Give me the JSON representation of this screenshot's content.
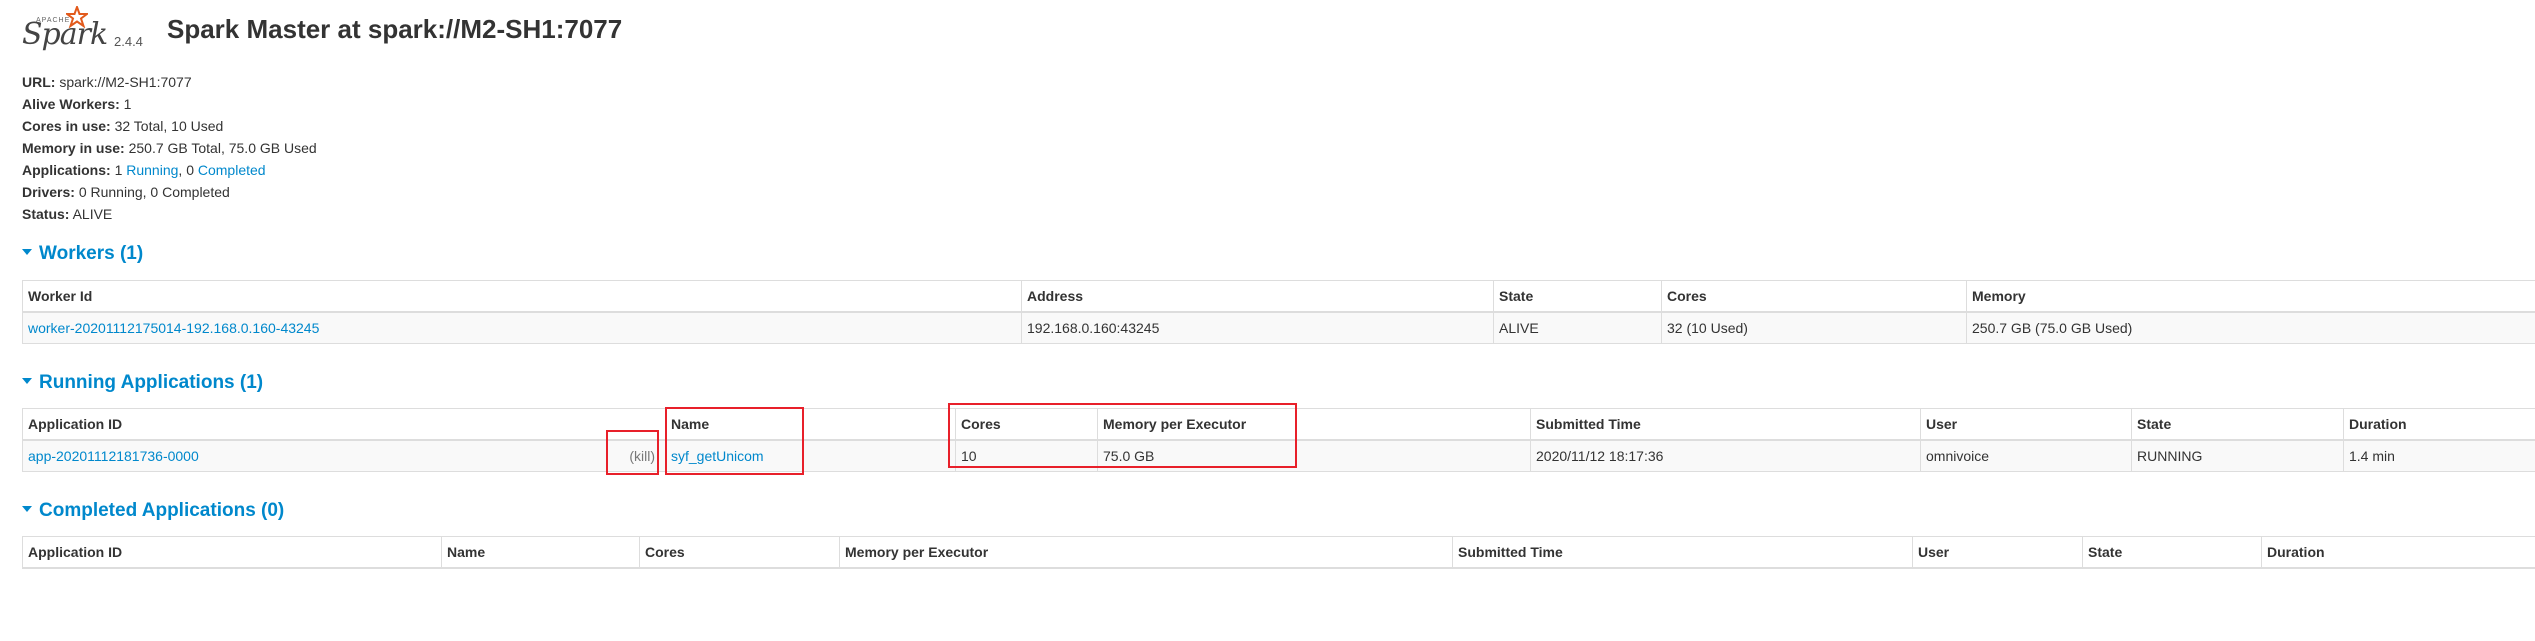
{
  "logo": {
    "word": "Spark",
    "apache": "APACHE",
    "version": "2.4.4"
  },
  "title": "Spark Master at spark://M2-SH1:7077",
  "summary": {
    "url_label": "URL:",
    "url_value": "spark://M2-SH1:7077",
    "alive_label": "Alive Workers:",
    "alive_value": "1",
    "cores_label": "Cores in use:",
    "cores_value": "32 Total, 10 Used",
    "memory_label": "Memory in use:",
    "memory_value": "250.7 GB Total, 75.0 GB Used",
    "apps_label": "Applications:",
    "apps_running_count": "1",
    "apps_running_link": "Running",
    "apps_sep": ",",
    "apps_completed_count": "0",
    "apps_completed_link": "Completed",
    "drivers_label": "Drivers:",
    "drivers_value": "0 Running, 0 Completed",
    "status_label": "Status:",
    "status_value": "ALIVE"
  },
  "workers": {
    "heading": "Workers (1)",
    "columns": [
      "Worker Id",
      "Address",
      "State",
      "Cores",
      "Memory"
    ],
    "rows": [
      {
        "id": "worker-20201112175014-192.168.0.160-43245",
        "address": "192.168.0.160:43245",
        "state": "ALIVE",
        "cores": "32 (10 Used)",
        "memory": "250.7 GB (75.0 GB Used)"
      }
    ]
  },
  "running": {
    "heading": "Running Applications (1)",
    "columns": [
      "Application ID",
      "Name",
      "Cores",
      "Memory per Executor",
      "Submitted Time",
      "User",
      "State",
      "Duration"
    ],
    "rows": [
      {
        "id": "app-20201112181736-0000",
        "kill": "(kill)",
        "name": "syf_getUnicom",
        "cores": "10",
        "memory": "75.0 GB",
        "submitted": "2020/11/12 18:17:36",
        "user": "omnivoice",
        "state": "RUNNING",
        "duration": "1.4 min"
      }
    ]
  },
  "completed": {
    "heading": "Completed Applications (0)",
    "columns": [
      "Application ID",
      "Name",
      "Cores",
      "Memory per Executor",
      "Submitted Time",
      "User",
      "State",
      "Duration"
    ]
  },
  "colors": {
    "link": "#0088cc",
    "highlight": "#e8202a"
  }
}
